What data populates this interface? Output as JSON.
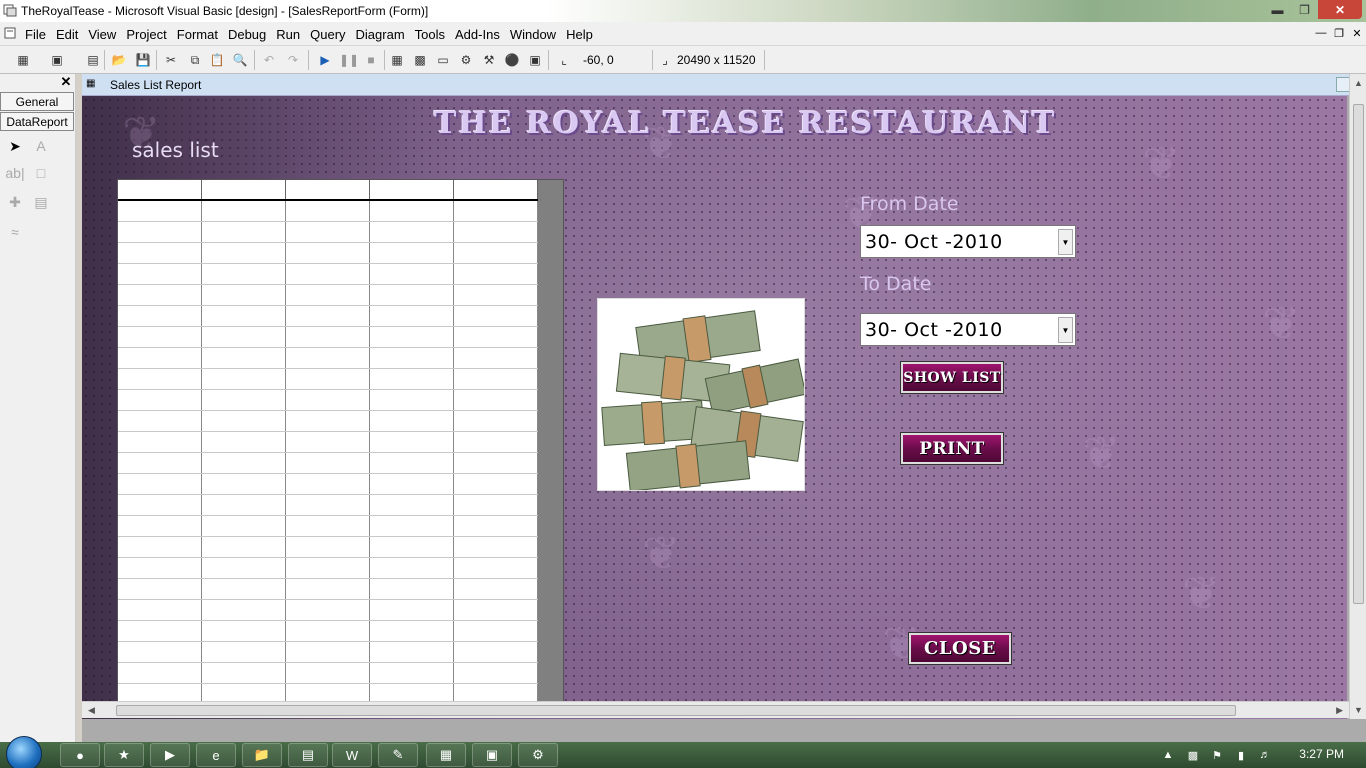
{
  "window": {
    "title": "TheRoyalTease - Microsoft Visual Basic [design] - [SalesReportForm (Form)]"
  },
  "menubar": {
    "items": [
      "File",
      "Edit",
      "View",
      "Project",
      "Format",
      "Debug",
      "Run",
      "Query",
      "Diagram",
      "Tools",
      "Add-Ins",
      "Window",
      "Help"
    ]
  },
  "toolbar": {
    "position": "-60, 0",
    "size": "20490 x 11520"
  },
  "toolbox": {
    "tabs": [
      "General",
      "DataReport"
    ]
  },
  "child_window": {
    "title": "Sales List Report"
  },
  "form": {
    "heading": "THE ROYAL TEASE RESTAURANT",
    "sales_label": "sales list",
    "from_date_label": "From Date",
    "from_date_value": "30- Oct -2010",
    "to_date_label": "To Date",
    "to_date_value": "30- Oct -2010",
    "show_list_button": "SHOW LIST",
    "print_button": "PRINT",
    "close_button": "CLOSE"
  },
  "taskbar": {
    "clock": "3:27 PM"
  }
}
